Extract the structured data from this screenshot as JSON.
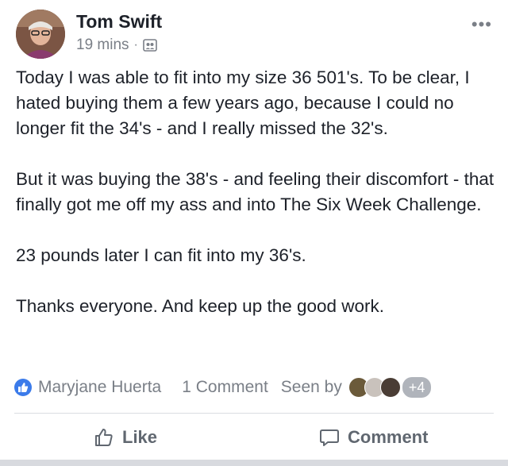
{
  "post": {
    "author": "Tom Swift",
    "time": "19 mins",
    "separator": "·",
    "privacy_icon": "friends-icon",
    "more_icon": "•••",
    "body": "Today I was able to fit into my size 36 501's. To be clear, I hated buying them a few years ago, because I could no longer fit the 34's - and I really missed the 32's.\n\nBut it was buying the 38's - and feeling their discomfort - that finally got me off my ass and into The Six Week Challenge.\n\n23 pounds later I can fit into my 36's.\n\nThanks everyone. And keep up the good work."
  },
  "reactions": {
    "reactor": "Maryjane Huerta",
    "comments": "1 Comment",
    "seen_by_label": "Seen by",
    "more_viewers": "+4"
  },
  "actions": {
    "like_label": "Like",
    "comment_label": "Comment"
  },
  "colors": {
    "like_blue": "#3b7bea",
    "meta_gray": "#7a7f87",
    "action_gray": "#606770"
  }
}
